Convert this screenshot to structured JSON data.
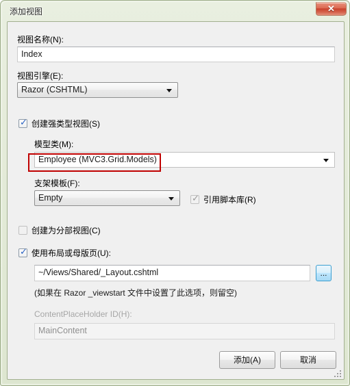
{
  "window": {
    "title": "添加视图",
    "close_label": "✕",
    "close_icon": "close-icon"
  },
  "fields": {
    "view_name": {
      "label": "视图名称(N):",
      "value": "Index"
    },
    "view_engine": {
      "label": "视图引擎(E):",
      "value": "Razor (CSHTML)"
    },
    "strongly_typed": {
      "label": "创建强类型视图(S)",
      "checked": true
    },
    "model_class": {
      "label": "模型类(M):",
      "value": "Employee (MVC3.Grid.Models)"
    },
    "scaffold_template": {
      "label": "支架模板(F):",
      "value": "Empty"
    },
    "reference_script_libraries": {
      "label": "引用脚本库(R)",
      "checked": true
    },
    "create_partial_view": {
      "label": "创建为分部视图(C)",
      "checked": false
    },
    "use_layout": {
      "label": "使用布局或母版页(U):",
      "checked": true,
      "value": "~/Views/Shared/_Layout.cshtml",
      "browse_label": "...",
      "hint": "(如果在 Razor _viewstart 文件中设置了此选项，则留空)"
    },
    "content_placeholder": {
      "label": "ContentPlaceHolder ID(H):",
      "value": "MainContent"
    }
  },
  "buttons": {
    "add": "添加(A)",
    "cancel": "取消"
  },
  "annotation": {
    "highlight_color": "#c00000",
    "target": "model_class_value"
  }
}
